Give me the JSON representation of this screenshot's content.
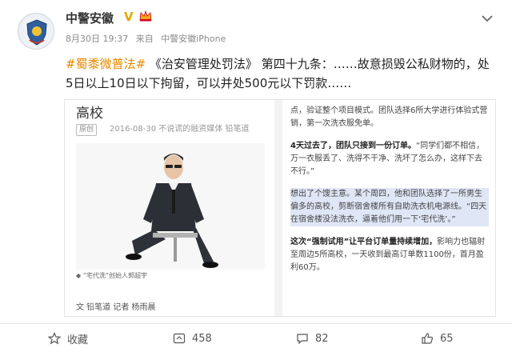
{
  "post": {
    "username": "中警安徽",
    "verified_mark": "V",
    "date": "8月30日 19:37",
    "via_prefix": "来自",
    "source": "中警安徽iPhone",
    "hashtag": "#蜀黍微普法#",
    "law_title": "《治安管理处罚法》",
    "text_rest": "第四十九条：……故意损毁公私财物的，处5日以上10日以下拘留，可以并处500元以下罚款……"
  },
  "article": {
    "title": "高校",
    "tag": "原创",
    "meta": "2016-08-30  不说谎的融资媒体  铅笔道",
    "photo_caption": "◆ “宅代洗”创始人郭超宇",
    "byline": "文  铅笔道  记者  杨雨晨",
    "right_paragraphs": [
      {
        "bold": "",
        "text": "点，验证整个项目模式。团队选择6所大学进行体验式营销，第一次洗衣服免单。"
      },
      {
        "bold": "4天过去了，团队只接到一份订单。",
        "text": "“同学们都不相信，万一衣服丢了、洗得不干净、洗坏了怎么办，这样下去不行。”"
      },
      {
        "bold": "",
        "text": "想出了个馊主意。某个周四，他和团队选择了一所男生偏多的高校，剪断宿舍楼所有自助洗衣机电源线。“四天在宿舍楼没法洗衣，逼着他们用一下‘宅代洗’。”",
        "highlight": true
      },
      {
        "bold": "这次“强制试用”让平台订单量持续增加，",
        "text": "影响力也辐射至周边5所高校，一天收到最高订单数1100份，首月盈利60万。"
      }
    ]
  },
  "actions": {
    "favorite_label": "收藏",
    "repost_count": "458",
    "comment_count": "82",
    "like_count": "65"
  },
  "icons": [
    "avatar-emblem",
    "crown-badge-icon",
    "chevron-down-icon",
    "star-icon",
    "repost-icon",
    "comment-icon",
    "like-icon"
  ],
  "colors": {
    "hashtag": "#e68a00",
    "verified": "#e0a800",
    "highlight": "#dfe6f6"
  }
}
